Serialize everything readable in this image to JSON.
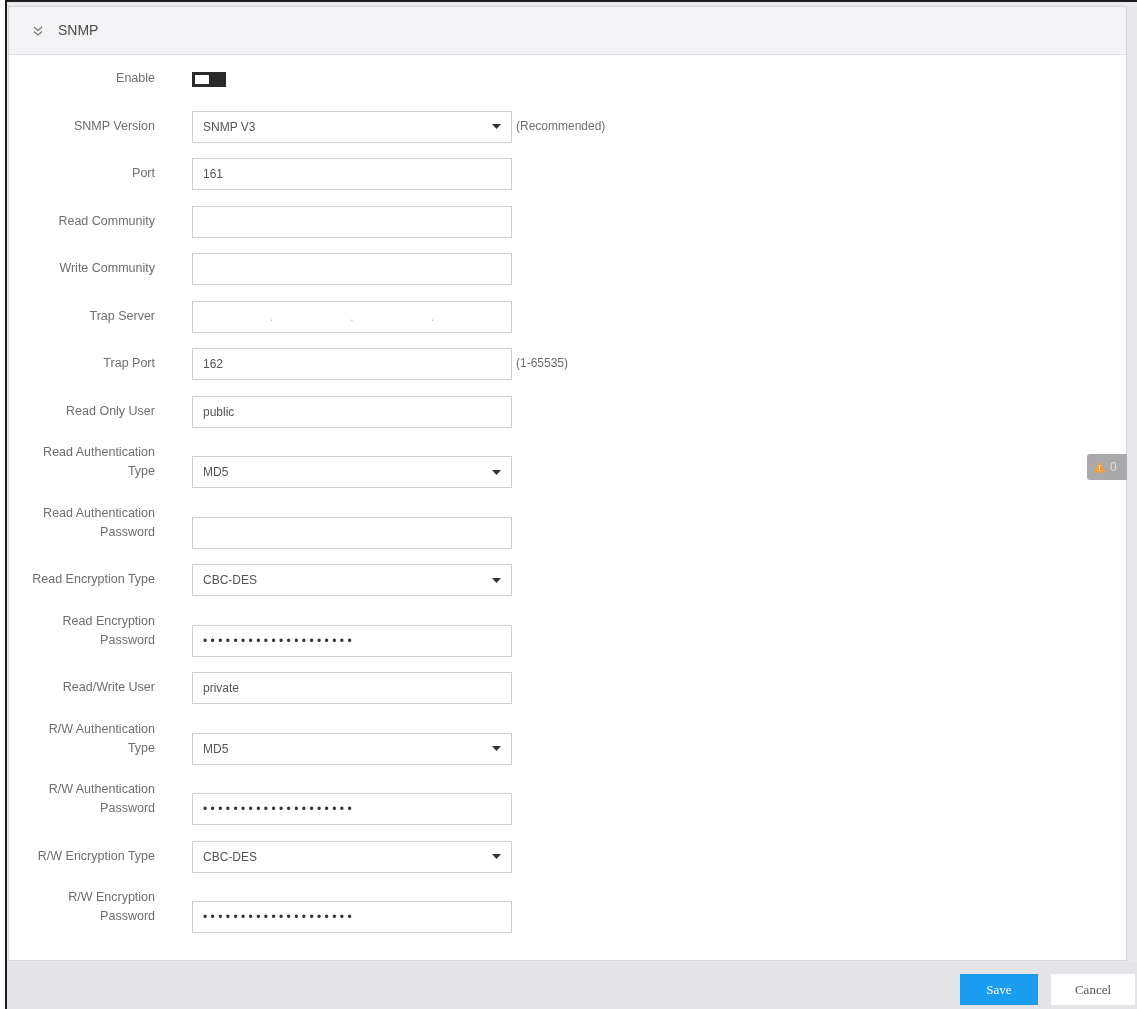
{
  "panel": {
    "title": "SNMP"
  },
  "fields": [
    {
      "kind": "toggle",
      "label": "Enable",
      "on": false
    },
    {
      "kind": "select",
      "label": "SNMP Version",
      "value": "SNMP V3",
      "hint": "(Recommended)"
    },
    {
      "kind": "text",
      "label": "Port",
      "value": "161"
    },
    {
      "kind": "text",
      "label": "Read Community"
    },
    {
      "kind": "text",
      "label": "Write Community"
    },
    {
      "kind": "ip",
      "label": "Trap Server",
      "separators": [
        ".",
        ".",
        "."
      ]
    },
    {
      "kind": "text",
      "label": "Trap Port",
      "value": "162",
      "hint": "(1-65535)"
    },
    {
      "kind": "text",
      "label": "Read Only User",
      "value": "public"
    },
    {
      "kind": "select",
      "label": "Read Authentication Type",
      "value": "MD5"
    },
    {
      "kind": "password",
      "label": "Read Authentication Password"
    },
    {
      "kind": "select",
      "label": "Read Encryption Type",
      "value": "CBC-DES"
    },
    {
      "kind": "password",
      "label": "Read Encryption Password",
      "value": "••••••••••••••••••••"
    },
    {
      "kind": "text",
      "label": "Read/Write User",
      "value": "private"
    },
    {
      "kind": "select",
      "label": "R/W Authentication Type",
      "value": "MD5"
    },
    {
      "kind": "password",
      "label": "R/W Authentication Password",
      "value": "••••••••••••••••••••"
    },
    {
      "kind": "select",
      "label": "R/W Encryption Type",
      "value": "CBC-DES"
    },
    {
      "kind": "password",
      "label": "R/W Encryption Password",
      "value": "••••••••••••••••••••"
    }
  ],
  "warning_badge": {
    "count": "0"
  },
  "footer": {
    "buttons": [
      {
        "label": "Save",
        "kind": "primary"
      },
      {
        "label": "Cancel",
        "kind": "secondary"
      }
    ]
  }
}
